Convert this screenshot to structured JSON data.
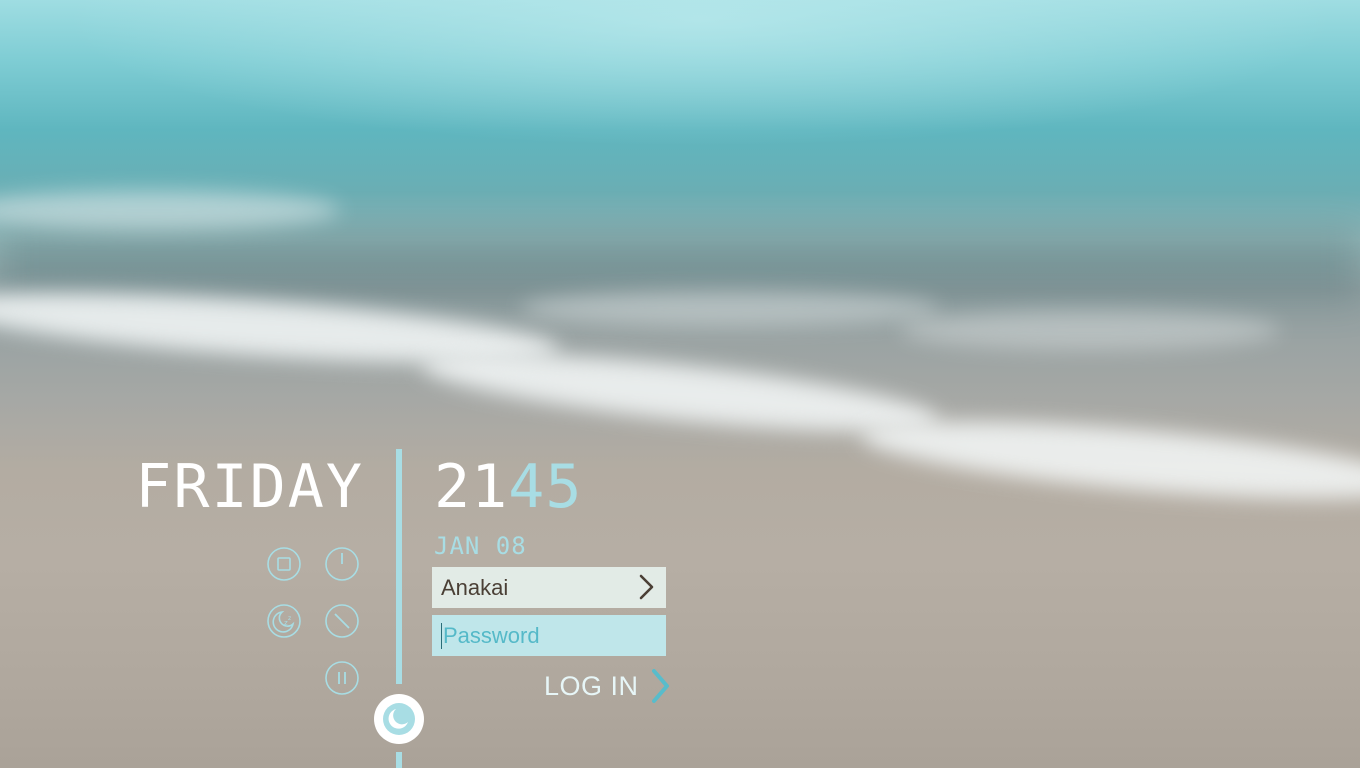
{
  "clock": {
    "day": "FRIDAY",
    "hour": "21",
    "minute": "45",
    "date": "JAN 08"
  },
  "login_form": {
    "username": "Anakai",
    "password_placeholder": "Password",
    "login_label": "LOG IN"
  },
  "power_actions": [
    {
      "name": "stop",
      "icon": "square-icon"
    },
    {
      "name": "power",
      "icon": "power-icon"
    },
    {
      "name": "sleep",
      "icon": "sleep-icon"
    },
    {
      "name": "restart",
      "icon": "restart-icon"
    },
    {
      "name": "hibernate",
      "icon": "pause-icon"
    }
  ],
  "session": {
    "icon": "moon-icon"
  },
  "colors": {
    "accent": "#a8dde4",
    "accent_strong": "#58bccb",
    "text_light": "#ffffff",
    "username_field_bg": "#e2ebe6",
    "password_field_bg": "#bfe6ea",
    "username_text": "#4a3f35"
  }
}
